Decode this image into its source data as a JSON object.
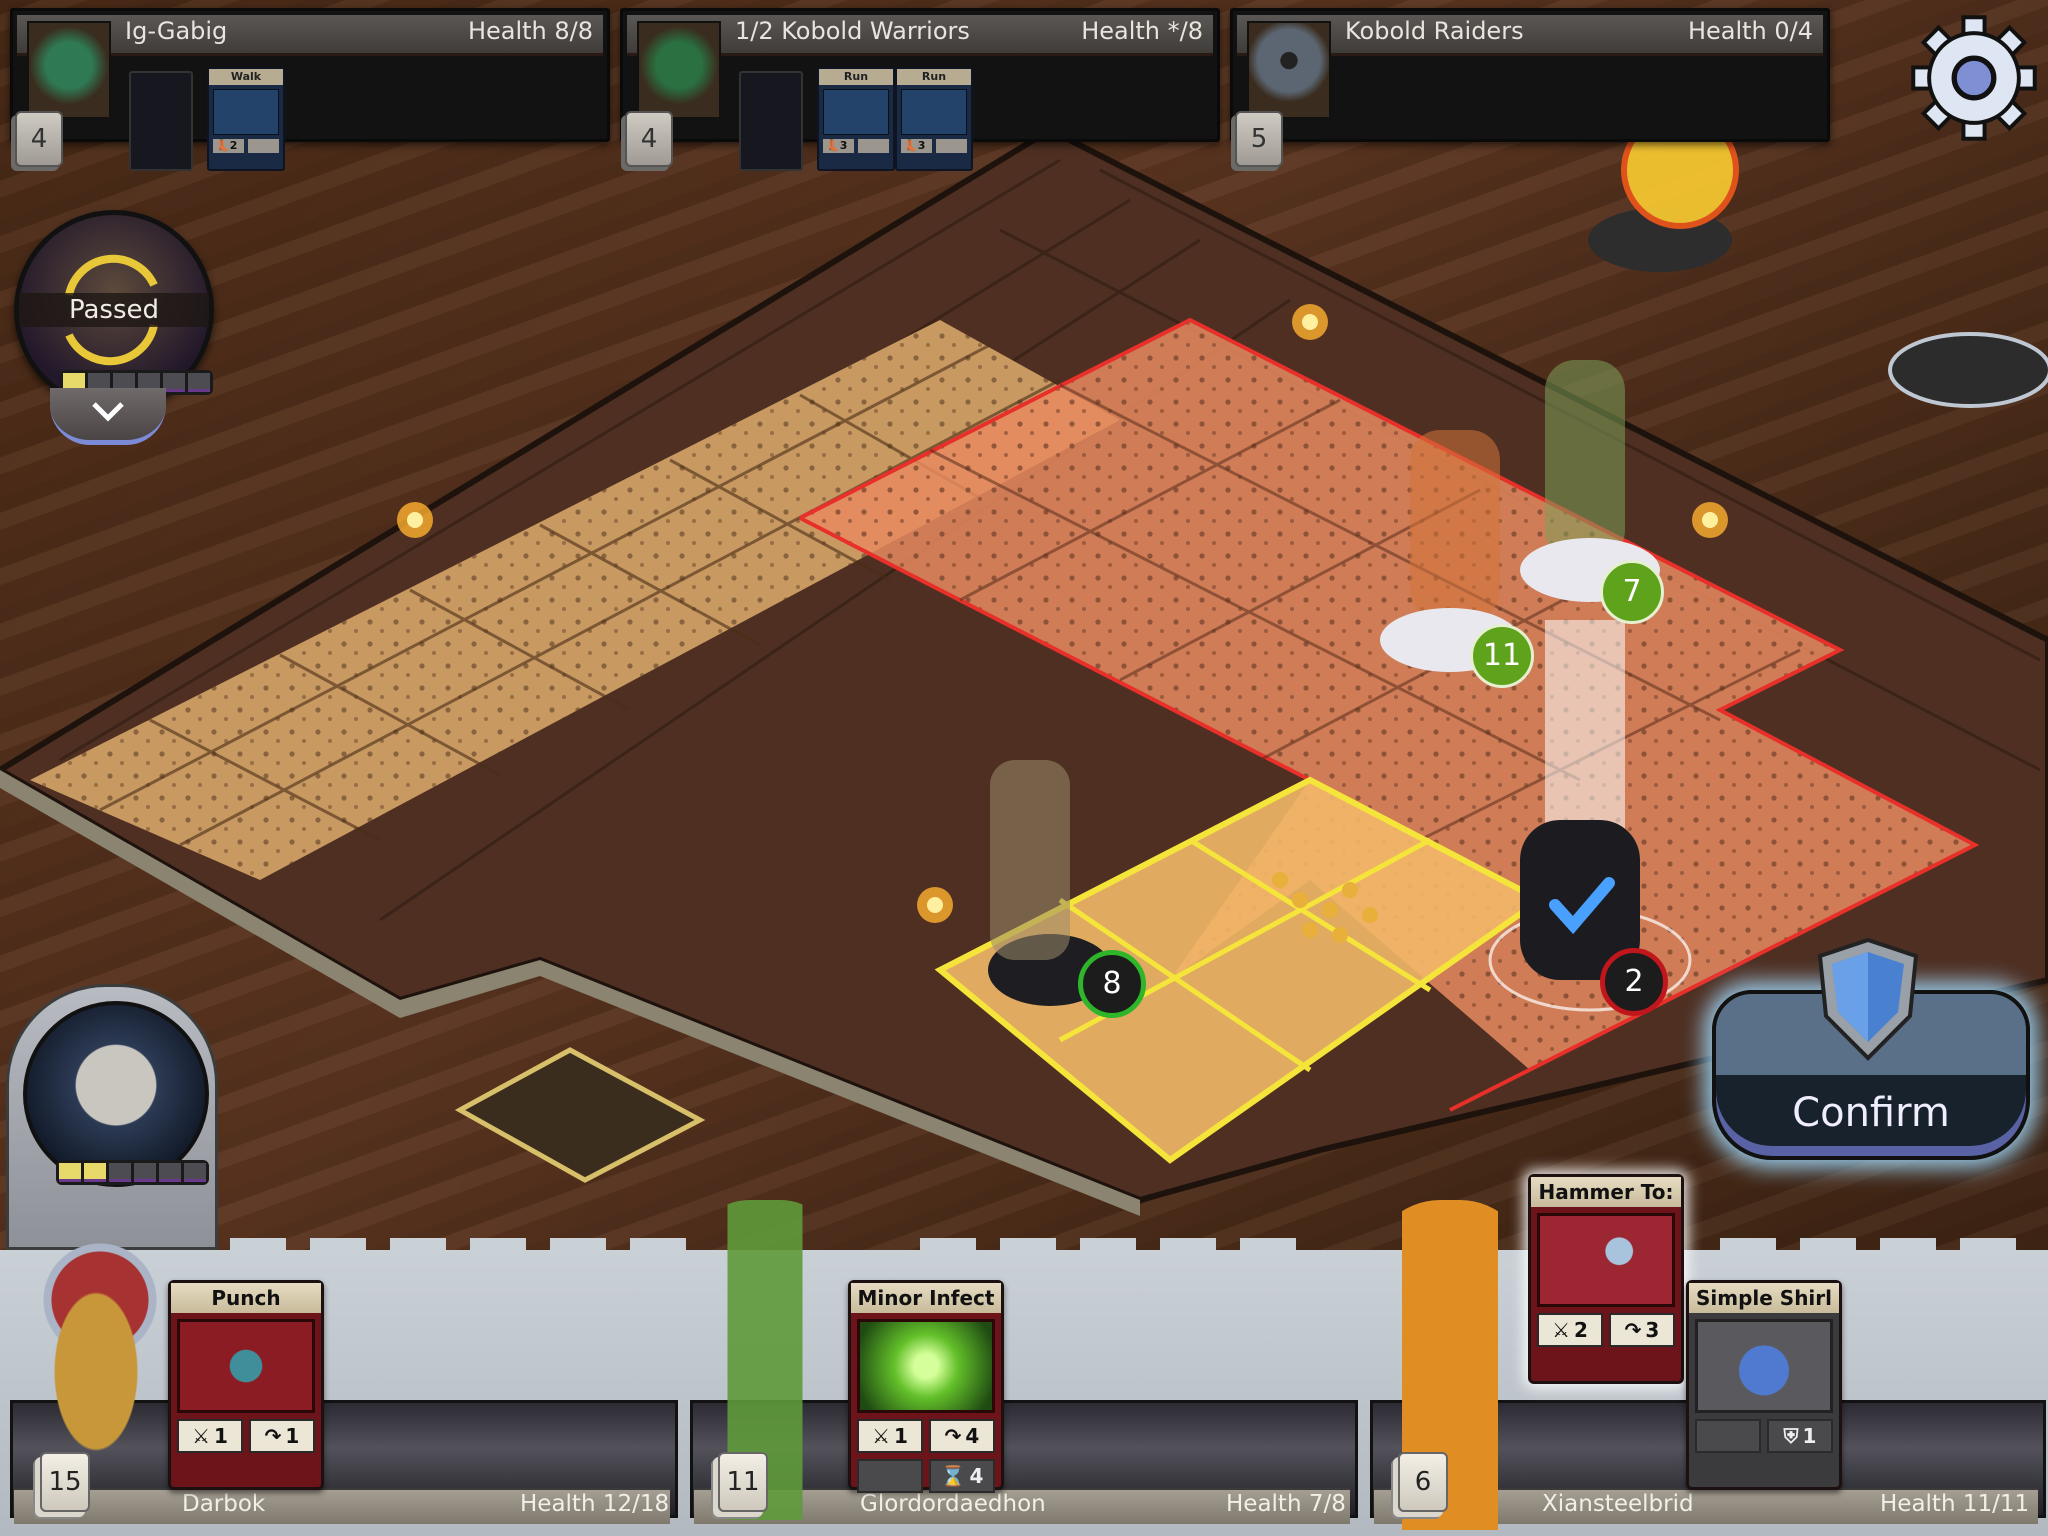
{
  "enemies": [
    {
      "name": "Ig-Gabig",
      "health": "Health 8/8",
      "deck_count": "4",
      "portrait": "goblin-portrait",
      "cards": [
        {
          "title": "Walk",
          "move": "2"
        }
      ]
    },
    {
      "name": "1/2 Kobold Warriors",
      "health": "Health */8",
      "deck_count": "4",
      "portrait": "kobold-portrait",
      "cards": [
        {
          "title": "Run",
          "move": "3"
        },
        {
          "title": "Run",
          "move": "3"
        }
      ]
    },
    {
      "name": "Kobold Raiders",
      "health": "Health 0/4",
      "deck_count": "5",
      "portrait": "skull-tombstone-portrait",
      "cards": []
    }
  ],
  "status_avatar": {
    "label": "Passed",
    "energy": {
      "filled": 1,
      "total": 6
    }
  },
  "active_player": {
    "energy": {
      "filled": 2,
      "total": 6
    }
  },
  "board_tokens": [
    {
      "value": "11",
      "style": "green",
      "side": "ally-ghost"
    },
    {
      "value": "7",
      "style": "green",
      "side": "ally-ghost"
    },
    {
      "value": "8",
      "style": "green-ring",
      "side": "enemy"
    },
    {
      "value": "2",
      "style": "red-ring",
      "side": "enemy-selected"
    }
  ],
  "heroes": [
    {
      "name": "Darbok",
      "health": "Health 12/18",
      "deck_count": "15",
      "cards": [
        {
          "title": "Punch",
          "attack": "1",
          "range": "1"
        }
      ]
    },
    {
      "name": "Glordordaedhon",
      "health": "Health 7/8",
      "deck_count": "11",
      "cards": [
        {
          "title": "Minor Infect",
          "attack": "1",
          "range": "4",
          "duration": "4"
        }
      ]
    },
    {
      "name": "Xiansteelbrid",
      "health": "Health 11/11",
      "deck_count": "6",
      "cards": [
        {
          "title": "Hammer To:",
          "attack": "2",
          "range": "3"
        },
        {
          "title": "Simple Shirl",
          "armor": "1"
        }
      ]
    }
  ],
  "confirm_button": {
    "label": "Confirm"
  },
  "colors": {
    "highlight_yellow": "#f5e53a",
    "range_red": "#e8302a",
    "ally_green": "#5fa31c",
    "enemy_red": "#c1161c"
  }
}
